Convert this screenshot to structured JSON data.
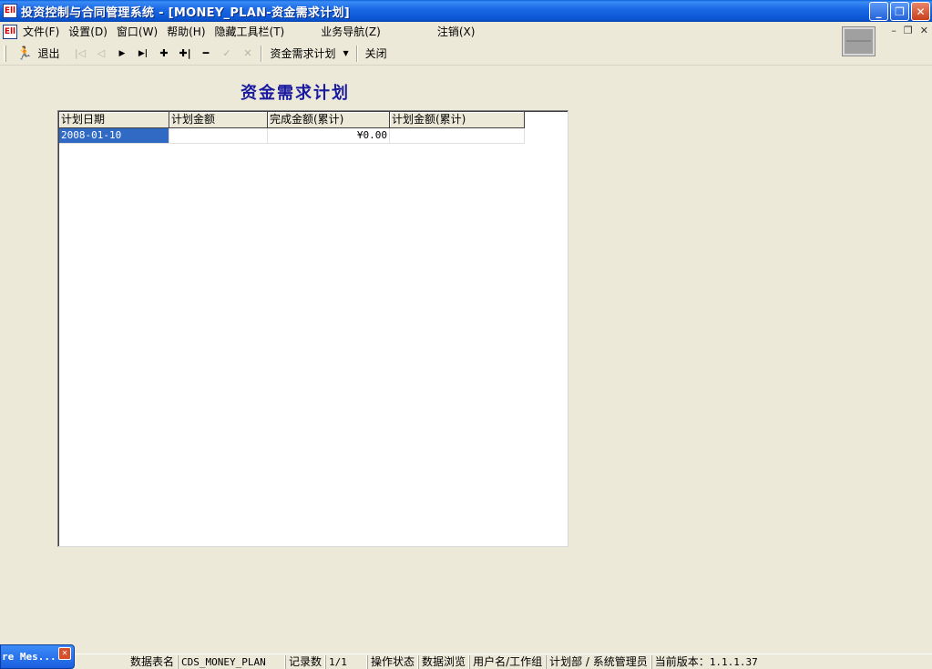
{
  "window": {
    "app_icon_text": "Ell",
    "title": "投资控制与合同管理系统 - [MONEY_PLAN-资金需求计划]",
    "minimize": "_",
    "restore": "❐",
    "close": "✕"
  },
  "menubar": {
    "items": [
      "文件(F)",
      "设置(D)",
      "窗口(W)",
      "帮助(H)",
      "隐藏工具栏(T)",
      "业务导航(Z)",
      "注销(X)"
    ],
    "mdi_minimize": "–",
    "mdi_restore": "❐",
    "mdi_close": "✕"
  },
  "toolbar": {
    "exit_label": "退出",
    "nav_first": "|◁",
    "nav_prev": "◁",
    "nav_next": "▶",
    "nav_last": "▶|",
    "add": "✚",
    "insert": "✚|",
    "delete": "━",
    "confirm": "✓",
    "cancel": "✕",
    "dropdown_label": "资金需求计划",
    "dropdown_arrow": "▼",
    "close_label": "关闭"
  },
  "form": {
    "title": "资金需求计划"
  },
  "grid": {
    "columns": [
      "计划日期",
      "计划金额",
      "完成金额(累计)",
      "计划金额(累计)"
    ],
    "rows": [
      [
        "2008-01-10",
        "",
        "¥0.00",
        ""
      ]
    ]
  },
  "statusbar": {
    "table_label": "数据表名",
    "table_value": "CDS_MONEY_PLAN",
    "records_label": "记录数",
    "records_value": "1/1",
    "state_label": "操作状态",
    "state_value": "数据浏览",
    "user_label": "用户名/工作组",
    "user_value": "计划部 / 系统管理员",
    "version_label": "当前版本：",
    "version_value": "1.1.1.37"
  },
  "taskbar": {
    "button_label": "re Mes...",
    "close": "✕"
  }
}
